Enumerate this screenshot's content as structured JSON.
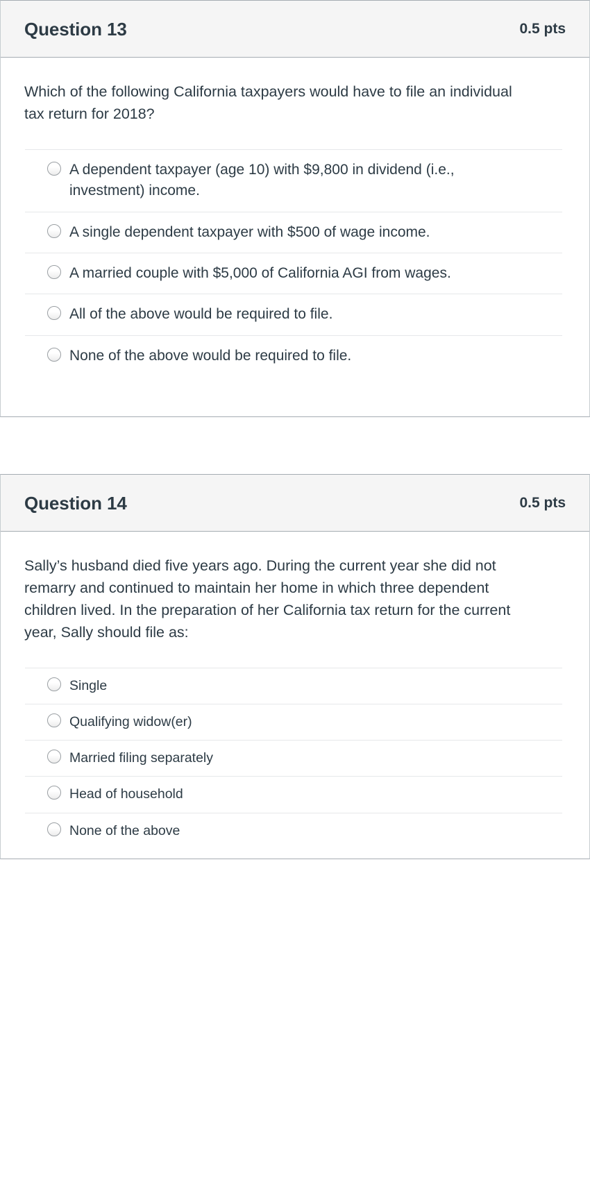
{
  "questions": [
    {
      "title": "Question 13",
      "points": "0.5 pts",
      "text": "Which of the following California taxpayers would have to file an individual tax return for 2018?",
      "options": [
        "A dependent taxpayer (age 10) with $9,800 in dividend (i.e., investment) income.",
        "A single dependent taxpayer with $500 of wage income.",
        "A married couple with $5,000 of California AGI from wages.",
        "All of the above would be required to file.",
        "None of the above would be required to file."
      ]
    },
    {
      "title": "Question 14",
      "points": "0.5 pts",
      "text": "Sally’s husband died five years ago. During the current year she did not remarry and continued to maintain her home in which three dependent children lived. In the preparation of her California tax return for the current year, Sally should file as:",
      "options": [
        "Single",
        "Qualifying widow(er)",
        "Married filing separately",
        "Head of household",
        "None of the above"
      ]
    }
  ],
  "colors": {
    "text": "#2d3b45",
    "header_background": "#f5f5f5",
    "header_border": "#a5acb2",
    "divider": "#e6e8ea",
    "radio_border": "#9a9fa3"
  }
}
